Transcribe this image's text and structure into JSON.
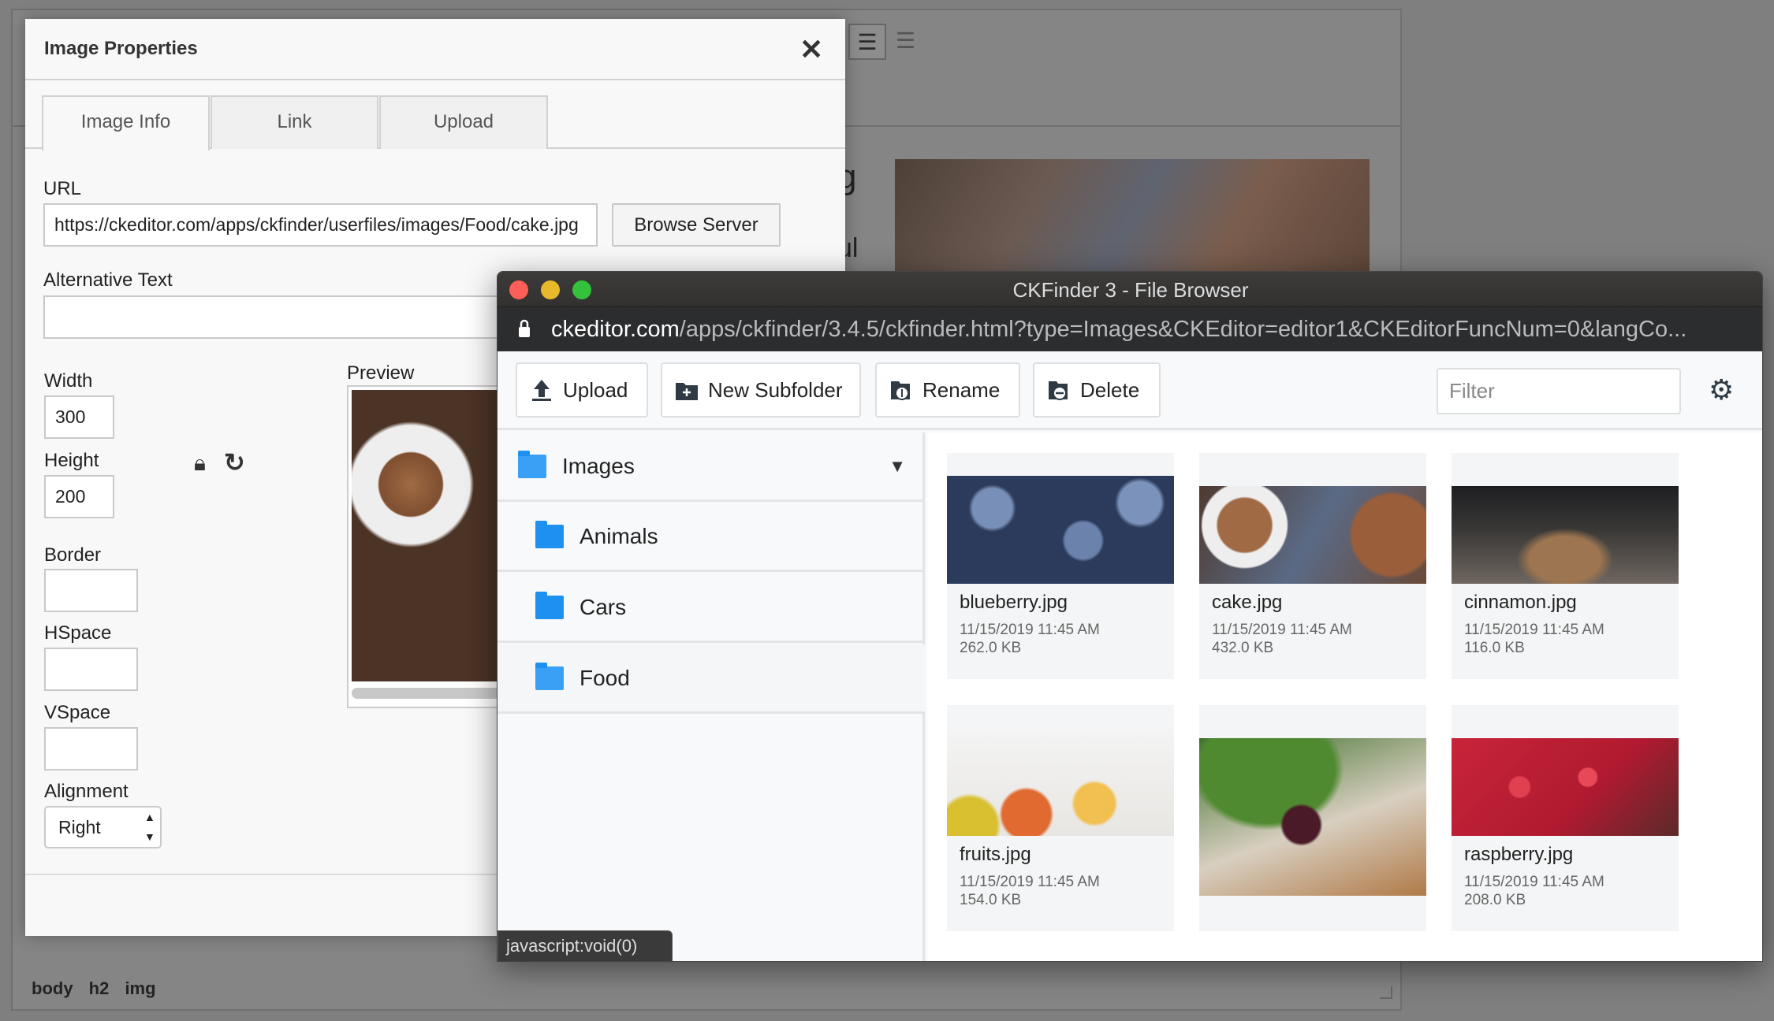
{
  "editor": {
    "path_text": "body  h2  img",
    "behind_text_1": "g",
    "behind_text_2": "ul",
    "align_right_icon": "align-right-icon",
    "justify_icon": "justify-icon"
  },
  "dialog": {
    "title": "Image Properties",
    "close_icon": "close-icon",
    "tabs": [
      {
        "label": "Image Info",
        "active": true
      },
      {
        "label": "Link"
      },
      {
        "label": "Upload"
      }
    ],
    "url_label": "URL",
    "url_value": "https://ckeditor.com/apps/ckfinder/userfiles/images/Food/cake.jpg",
    "browse_label": "Browse Server",
    "alt_label": "Alternative Text",
    "alt_value": "",
    "width_label": "Width",
    "width_value": "300",
    "height_label": "Height",
    "height_value": "200",
    "border_label": "Border",
    "border_value": "",
    "hspace_label": "HSpace",
    "hspace_value": "",
    "vspace_label": "VSpace",
    "vspace_value": "",
    "alignment_label": "Alignment",
    "alignment_value": "Right",
    "preview_label": "Preview"
  },
  "finder": {
    "window_title": "CKFinder 3 - File Browser",
    "address_host": "ckeditor.com",
    "address_rest": "/apps/ckfinder/3.4.5/ckfinder.html?type=Images&CKEditor=editor1&CKEditorFuncNum=0&langCo...",
    "toolbar": {
      "upload": "Upload",
      "new_subfolder": "New Subfolder",
      "rename": "Rename",
      "delete": "Delete",
      "filter_placeholder": "Filter"
    },
    "folders": {
      "root": "Images",
      "children": [
        "Animals",
        "Cars",
        "Food"
      ]
    },
    "files": [
      {
        "name": "blueberry.jpg",
        "date": "11/15/2019 11:45 AM",
        "size": "262.0 KB"
      },
      {
        "name": "cake.jpg",
        "date": "11/15/2019 11:45 AM",
        "size": "432.0 KB"
      },
      {
        "name": "cinnamon.jpg",
        "date": "11/15/2019 11:45 AM",
        "size": "116.0 KB"
      },
      {
        "name": "fruits.jpg",
        "date": "11/15/2019 11:45 AM",
        "size": "154.0 KB"
      },
      {
        "name": "",
        "date": "",
        "size": ""
      },
      {
        "name": "raspberry.jpg",
        "date": "11/15/2019 11:45 AM",
        "size": "208.0 KB"
      }
    ],
    "status_text": "javascript:void(0)",
    "traffic_colors": {
      "close": "#fc5f57",
      "minimize": "#e8b92b",
      "zoom": "#34c13b"
    }
  }
}
